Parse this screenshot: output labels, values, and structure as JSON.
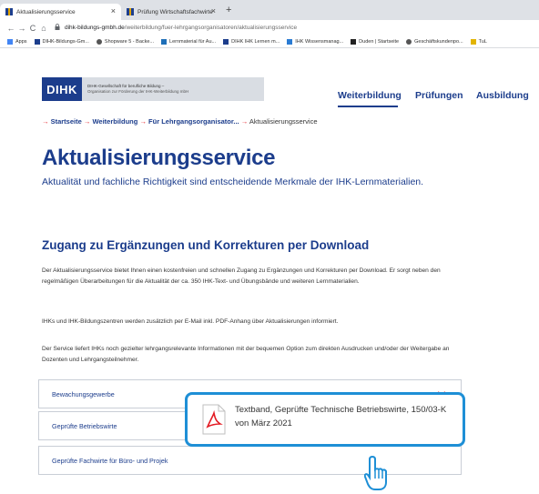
{
  "browser": {
    "tabs": [
      {
        "label": "Aktualisierungsservice",
        "close": "×"
      },
      {
        "label": "Prüfung Wirtschaftsfachwirte",
        "close": "×"
      }
    ],
    "new_tab": "+",
    "back": "←",
    "forward": "→",
    "reload": "C",
    "home": "⌂",
    "url_host": "dihk-bildungs-gmbh.de",
    "url_path": "/weiterbildung/fuer-lehrgangsorganisatoren/aktualisierungsservice",
    "bookmarks": [
      {
        "label": "Apps",
        "color": "#4285f4"
      },
      {
        "label": "DIHK-Bildungs-Gm...",
        "color": "#1c3d8c"
      },
      {
        "label": "Shopware 5 - Backe...",
        "color": "#555555"
      },
      {
        "label": "Lernmaterial für Au...",
        "color": "#1e6fb8"
      },
      {
        "label": "DIHK IHK Lernen m...",
        "color": "#1c3d8c"
      },
      {
        "label": "IHK Wissensmanag...",
        "color": "#2a7bd3"
      },
      {
        "label": "Duden | Startseite",
        "color": "#222222"
      },
      {
        "label": "Geschäftskundenpo...",
        "color": "#555555"
      },
      {
        "label": "TuL",
        "color": "#e2b400"
      }
    ]
  },
  "site": {
    "logo_mark": "DIHK",
    "logo_line1": "DIHK-Gesellschaft für berufliche Bildung –",
    "logo_line2": "Organisation zur Förderung der IHK-Weiterbildung mbH",
    "nav": [
      "Weiterbildung",
      "Prüfungen",
      "Ausbildung"
    ],
    "breadcrumb": {
      "arrow": "→",
      "items": [
        "Startseite",
        "Weiterbildung",
        "Für Lehrgangsorganisator..."
      ],
      "current": "Aktualisierungsservice"
    },
    "title": "Aktualisierungsservice",
    "lead": "Aktualität und fachliche Richtigkeit sind entscheidende Merkmale der IHK-Lernmaterialien.",
    "section_title": "Zugang zu Ergänzungen und Korrekturen per Download",
    "paragraphs": [
      "Der Aktualisierungsservice bietet Ihnen einen kostenfreien und schnellen Zugang zu Ergänzungen und Korrekturen per Download. Er sorgt neben den regelmäßigen Überarbeitungen für die Aktualität der ca. 350 IHK-Text- und Übungsbände und weiteren Lernmaterialien.",
      "IHKs und IHK-Bildungszentren werden zusätzlich per E-Mail inkl. PDF-Anhang über Aktualisierungen informiert.",
      "Der Service liefert IHKs noch gezielter lehrgangsrelevante Informationen mit der bequemen Option zum direkten Ausdrucken und/oder der Weitergabe an Dozenten und Lehrgangsteilnehmer."
    ],
    "accordion": [
      "Bewachungsgewerbe",
      "Geprüfte Betriebswirte",
      "Geprüfte Fachwirte für Büro- und Projek"
    ],
    "tooltip": "Textband, Geprüfte Technische Betriebswirte, 150/03-K von März 2021"
  },
  "colors": {
    "brand": "#1c3d8c",
    "accent": "#e31b23",
    "tooltip_border": "#1e8fd6"
  }
}
